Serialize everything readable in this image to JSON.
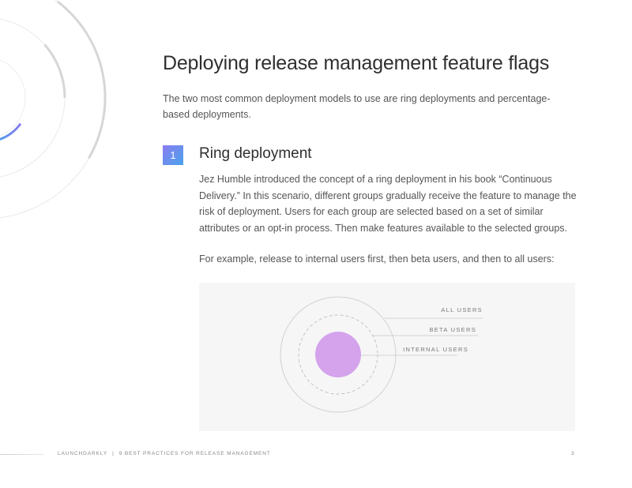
{
  "title": "Deploying release management feature flags",
  "intro": "The two most common deployment models to use are ring deployments and percentage-based deployments.",
  "section": {
    "number": "1",
    "heading": "Ring deployment",
    "paragraphs": [
      "Jez Humble introduced the concept of a ring deployment in his book “Continuous Delivery.” In this scenario, different groups gradually receive the feature to manage the risk of deployment. Users for each group are selected based on a set of similar attributes or an opt-in process. Then make features available to the selected groups.",
      "For example, release to internal users first, then beta users, and then to all users:"
    ]
  },
  "diagram": {
    "rings": [
      {
        "label": "ALL USERS"
      },
      {
        "label": "BETA USERS"
      },
      {
        "label": "INTERNAL USERS"
      }
    ],
    "colors": {
      "inner_fill": "#d4a3ec",
      "ring_stroke": "#c8c8c8",
      "panel_bg": "#f6f6f6"
    }
  },
  "footer": {
    "brand": "LAUNCHDARKLY",
    "separator": "|",
    "doc_title": "9 BEST PRACTICES FOR RELEASE MANAGEMENT",
    "page_number": "3"
  },
  "colors": {
    "badge_gradient_start": "#8a7cf0",
    "badge_gradient_end": "#4aa3ec",
    "text": "#555555",
    "heading": "#2f2f2f"
  }
}
